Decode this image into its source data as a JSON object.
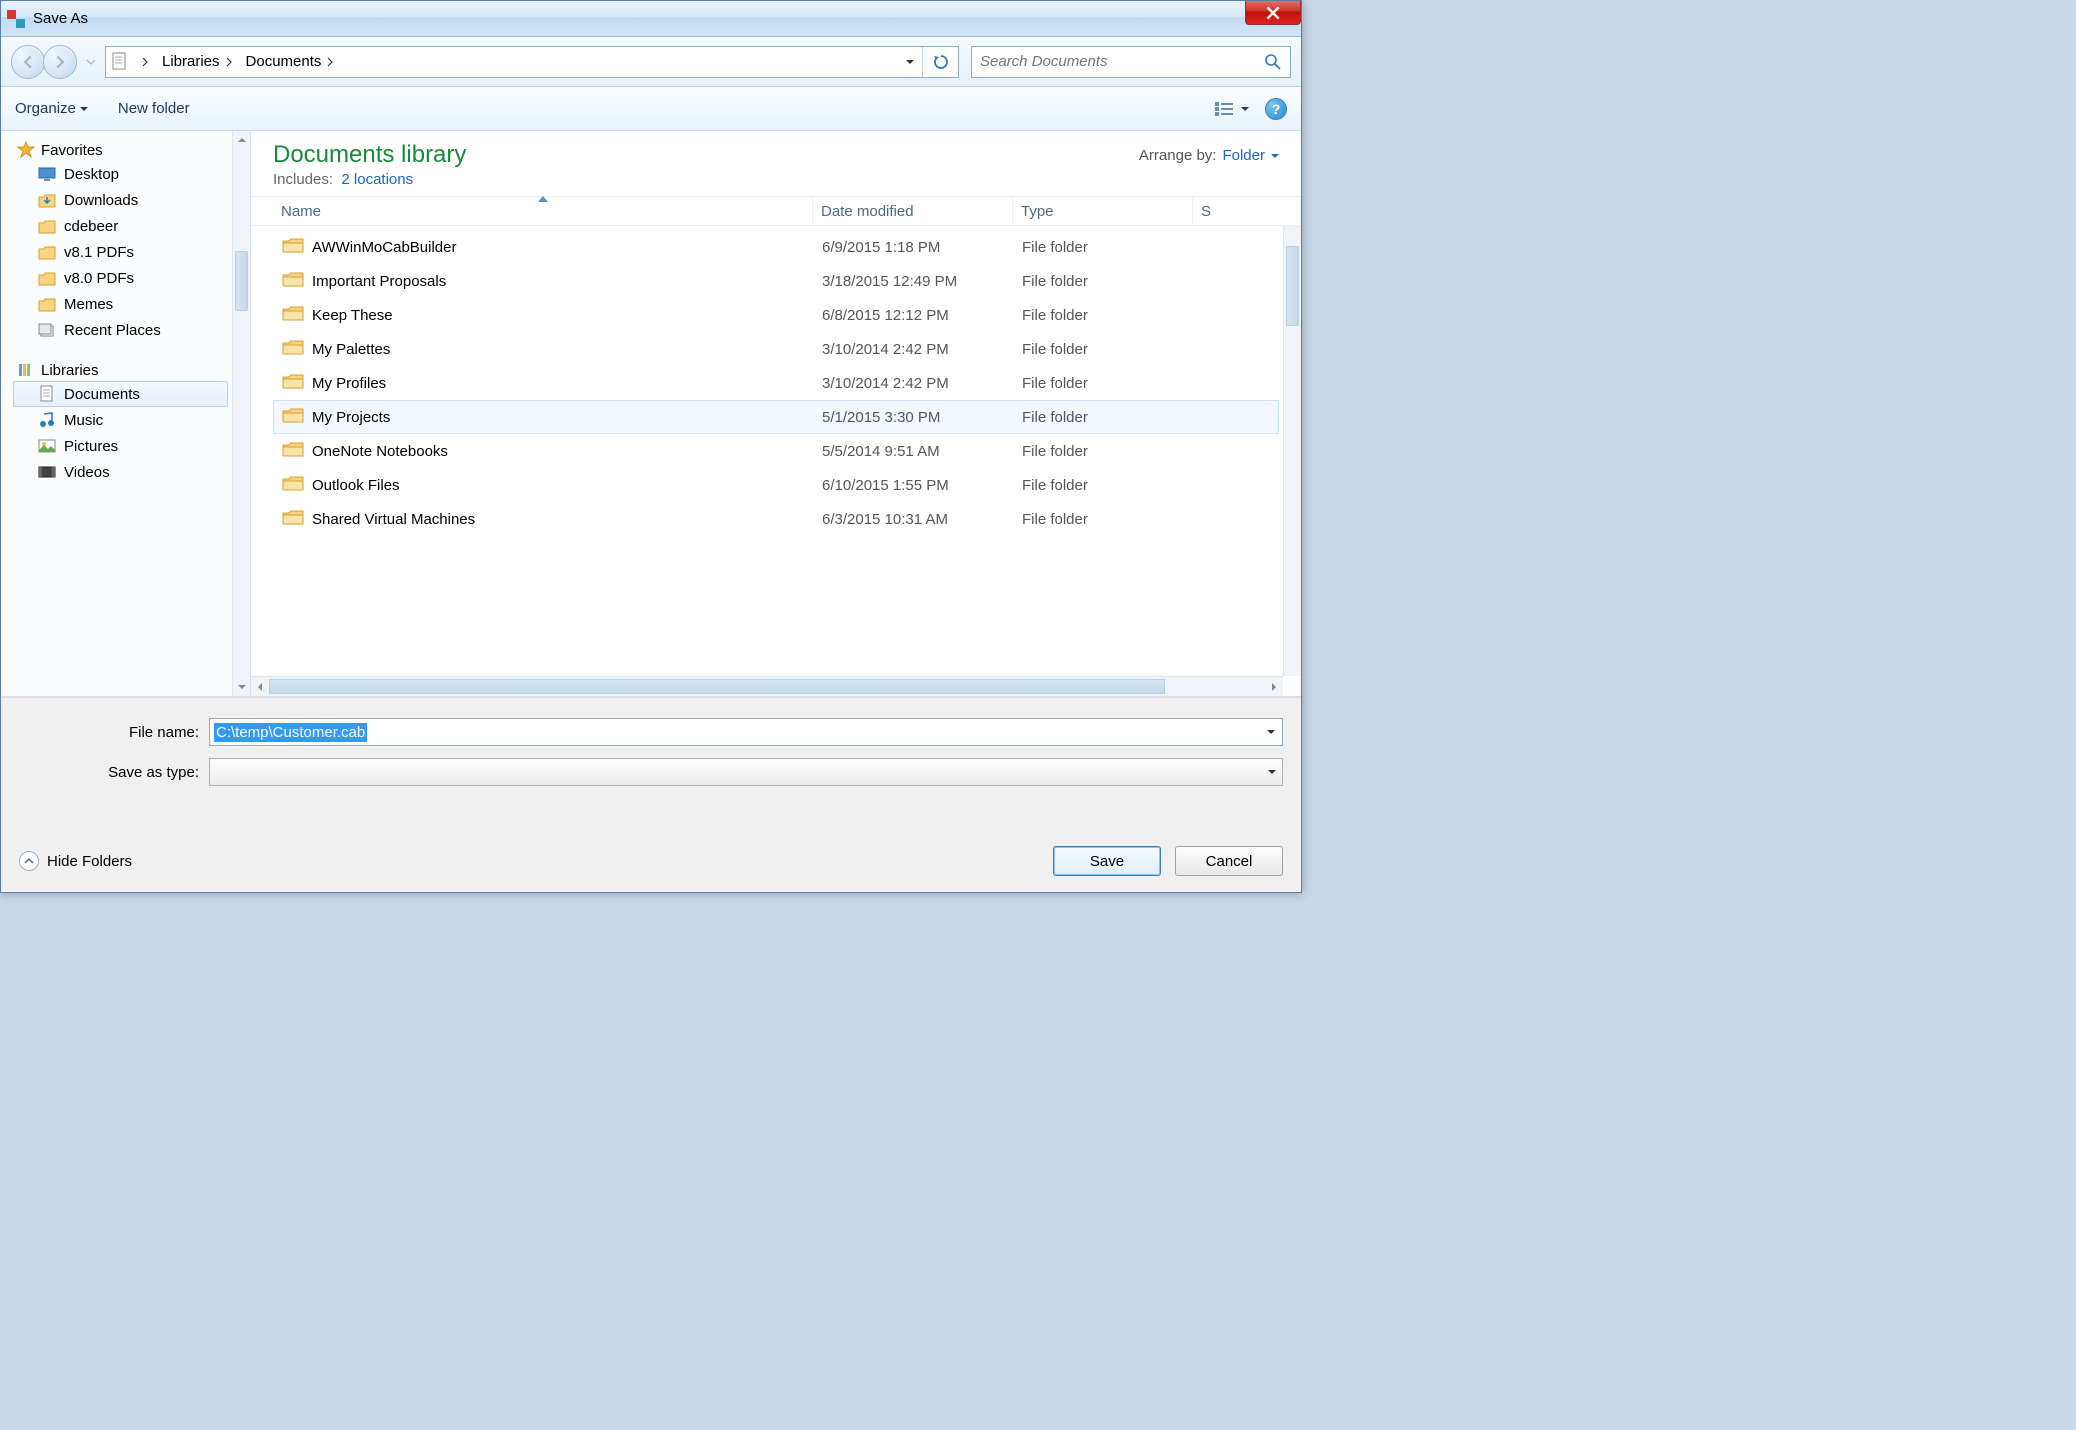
{
  "window": {
    "title": "Save As"
  },
  "breadcrumb": {
    "seg1": "Libraries",
    "seg2": "Documents"
  },
  "search": {
    "placeholder": "Search Documents"
  },
  "toolbar": {
    "organize": "Organize",
    "new_folder": "New folder"
  },
  "sidebar": {
    "favorites": "Favorites",
    "fav_items": [
      {
        "label": "Desktop",
        "icon": "desktop"
      },
      {
        "label": "Downloads",
        "icon": "downloads"
      },
      {
        "label": "cdebeer",
        "icon": "folder"
      },
      {
        "label": "v8.1 PDFs",
        "icon": "folder"
      },
      {
        "label": "v8.0 PDFs",
        "icon": "folder"
      },
      {
        "label": "Memes",
        "icon": "folder"
      },
      {
        "label": "Recent Places",
        "icon": "recent"
      }
    ],
    "libraries": "Libraries",
    "lib_items": [
      {
        "label": "Documents",
        "icon": "document",
        "selected": true
      },
      {
        "label": "Music",
        "icon": "music"
      },
      {
        "label": "Pictures",
        "icon": "pictures"
      },
      {
        "label": "Videos",
        "icon": "videos"
      }
    ]
  },
  "library_header": {
    "title": "Documents library",
    "includes_label": "Includes:",
    "includes_link": "2 locations",
    "arrange_label": "Arrange by:",
    "arrange_value": "Folder"
  },
  "columns": {
    "name": "Name",
    "date": "Date modified",
    "type": "Type",
    "size": "S"
  },
  "rows": [
    {
      "name": "AWWinMoCabBuilder",
      "date": "6/9/2015 1:18 PM",
      "type": "File folder"
    },
    {
      "name": "Important Proposals",
      "date": "3/18/2015 12:49 PM",
      "type": "File folder"
    },
    {
      "name": "Keep These",
      "date": "6/8/2015 12:12 PM",
      "type": "File folder"
    },
    {
      "name": "My Palettes",
      "date": "3/10/2014 2:42 PM",
      "type": "File folder"
    },
    {
      "name": "My Profiles",
      "date": "3/10/2014 2:42 PM",
      "type": "File folder"
    },
    {
      "name": "My Projects",
      "date": "5/1/2015 3:30 PM",
      "type": "File folder",
      "hovered": true
    },
    {
      "name": "OneNote Notebooks",
      "date": "5/5/2014 9:51 AM",
      "type": "File folder"
    },
    {
      "name": "Outlook Files",
      "date": "6/10/2015 1:55 PM",
      "type": "File folder"
    },
    {
      "name": "Shared Virtual Machines",
      "date": "6/3/2015 10:31 AM",
      "type": "File folder"
    }
  ],
  "form": {
    "file_name_label": "File name:",
    "file_name_value": "C:\\temp\\Customer.cab",
    "save_type_label": "Save as type:",
    "save_type_value": ""
  },
  "footer": {
    "hide_folders": "Hide Folders",
    "save": "Save",
    "cancel": "Cancel"
  }
}
